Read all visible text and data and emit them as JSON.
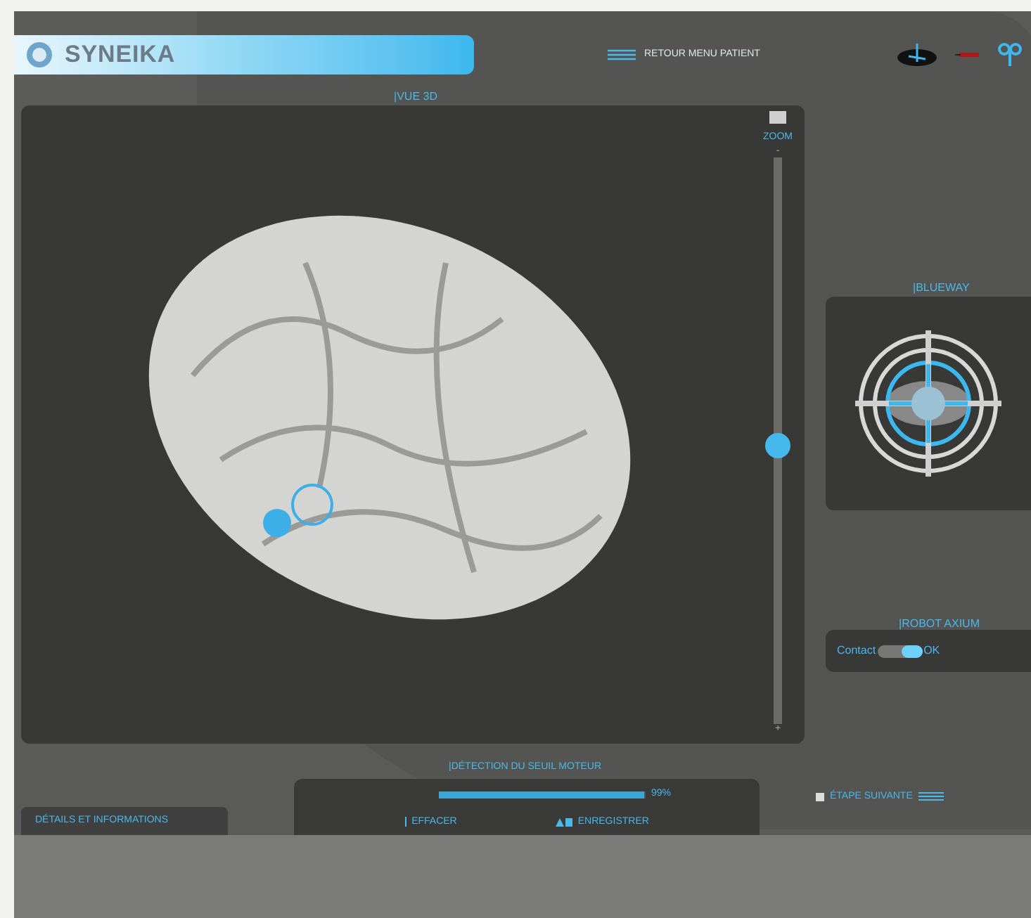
{
  "header": {
    "logo": "SYNEIKA",
    "menu_link": "RETOUR MENU PATIENT"
  },
  "view3d": {
    "title": "|VUE 3D",
    "zoom": {
      "label": "ZOOM",
      "minus": "-",
      "plus": "+",
      "level": 0.49
    }
  },
  "blueway": {
    "title": "|BLUEWAY"
  },
  "robot": {
    "title": "|ROBOT AXIUM",
    "left_label": "Contact",
    "right_label": "OK",
    "on": true
  },
  "detection": {
    "title": "|DÉTECTION DU SEUIL MOTEUR",
    "level": 0.99,
    "reading": "99%",
    "buttons": [
      {
        "kind": "clear",
        "label": "EFFACER"
      },
      {
        "kind": "save",
        "label": "ENREGISTRER"
      }
    ]
  },
  "details_tab": "DÉTAILS ET INFORMATIONS",
  "next_step": "ÉTAPE SUIVANTE"
}
